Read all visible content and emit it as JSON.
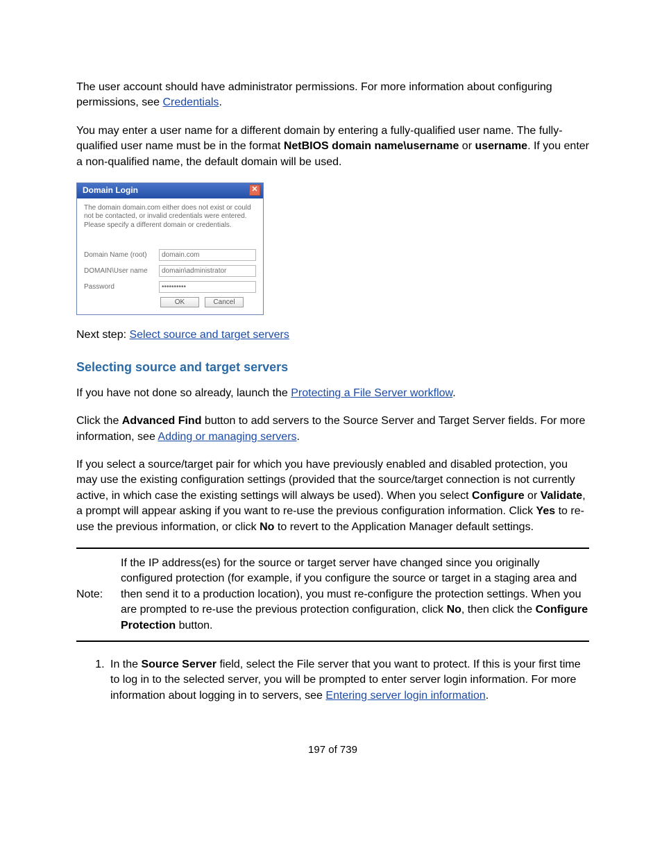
{
  "para1": {
    "t1": "The user account should have administrator permissions. For more information about configuring permissions, see ",
    "link": "Credentials",
    "t2": "."
  },
  "para2": {
    "t1": "You may enter a user name for a different domain by entering a fully-qualified user name. The fully-qualified user name must be in the format ",
    "b1": "NetBIOS domain name\\username",
    "t2": " or ",
    "b2": "username",
    "t3": ". If you enter a non-qualified name, the default domain will be used."
  },
  "dialog": {
    "title": "Domain Login",
    "message": "The domain domain.com either does not exist or could not be contacted, or invalid credentials were entered. Please specify a different domain or credentials.",
    "labels": {
      "domain": "Domain Name (root)",
      "user": "DOMAIN\\User name",
      "password": "Password"
    },
    "values": {
      "domain": "domain.com",
      "user": "domain\\administrator",
      "password": "**********"
    },
    "buttons": {
      "ok": "OK",
      "cancel": "Cancel"
    }
  },
  "nextstep": {
    "label": "Next step: ",
    "link": "Select source and target servers"
  },
  "heading": "Selecting source and target servers",
  "para3": {
    "t1": "If you have not done so already, launch the ",
    "link": "Protecting a File Server workflow",
    "t2": "."
  },
  "para4": {
    "t1": "Click the ",
    "b1": "Advanced Find",
    "t2": " button to add servers to the Source Server and Target Server fields. For more information, see ",
    "link": "Adding or managing servers",
    "t3": "."
  },
  "para5": {
    "t1": "If you select a source/target pair for which you have previously enabled and disabled protection, you may use the existing configuration settings (provided that the source/target connection is not currently active, in which case the existing settings will always be used). When you select ",
    "b1": "Configure",
    "t2": " or ",
    "b2": "Validate",
    "t3": ", a prompt will appear asking if you want to re-use the previous configuration information. Click ",
    "b3": "Yes",
    "t4": " to re-use the previous information, or click ",
    "b4": "No",
    "t5": " to revert to the Application Manager default settings."
  },
  "note": {
    "label": "Note:",
    "t1": "If the IP address(es) for the source or target server have changed since you originally configured protection (for example, if you configure the source or target in a staging area and then send it to a production location), you must re-configure the protection settings. When you are prompted to re-use the previous protection configuration, click ",
    "b1": "No",
    "t2": ", then click the ",
    "b2": "Configure Protection",
    "t3": " button."
  },
  "step1": {
    "t1": "In the ",
    "b1": "Source Server",
    "t2": " field, select the File server that you want to protect. If this is your first time to log in to the selected server, you will be prompted to enter server login information. For more information about logging in to servers, see ",
    "link": "Entering server login information",
    "t3": "."
  },
  "pagenum": "197 of 739"
}
